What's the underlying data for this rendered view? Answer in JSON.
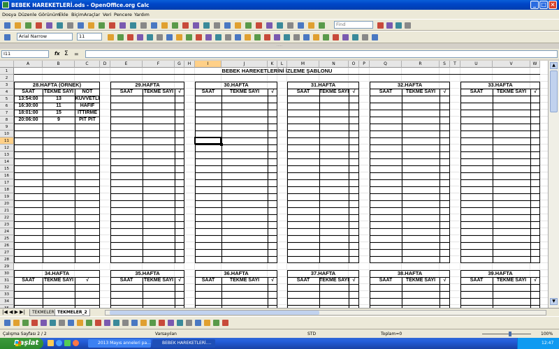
{
  "window": {
    "title": "BEBEK HAREKETLERİ.ods - OpenOffice.org Calc"
  },
  "menu": [
    "Dosya",
    "Düzenle",
    "Görünüm",
    "Ekle",
    "Biçim",
    "Araçlar",
    "Veri",
    "Pencere",
    "Yardım"
  ],
  "toolbar": {
    "find_placeholder": "Find"
  },
  "format": {
    "font": "Arial Narrow",
    "size": "11"
  },
  "formula": {
    "namebox": "I11",
    "value": ""
  },
  "columns": [
    "A",
    "B",
    "C",
    "D",
    "E",
    "F",
    "G",
    "H",
    "I",
    "J",
    "K",
    "L",
    "M",
    "N",
    "O",
    "P",
    "Q",
    "R",
    "S",
    "T",
    "U",
    "V",
    "W"
  ],
  "rows": [
    "1",
    "2",
    "3",
    "4",
    "5",
    "6",
    "7",
    "8",
    "9",
    "10",
    "11",
    "12",
    "13",
    "14",
    "15",
    "16",
    "17",
    "18",
    "19",
    "20",
    "21",
    "22",
    "23",
    "24",
    "25",
    "26",
    "27",
    "28",
    "29",
    "30",
    "31",
    "32",
    "33",
    "34",
    "35"
  ],
  "sheet": {
    "title": "BEBEK HAREKETLERİNİ İZLEME ŞABLONU",
    "top_weeks": [
      "28.HAFTA (ÖRNEK)",
      "29.HAFTA",
      "30.HAFTA",
      "31.HAFTA",
      "32.HAFTA",
      "33.HAFTA"
    ],
    "bottom_weeks": [
      "34.HAFTA",
      "35.HAFTA",
      "36.HAFTA",
      "37.HAFTA",
      "38.HAFTA",
      "39.HAFTA"
    ],
    "col_saat": "SAAT",
    "col_tekme": "TEKME SAYI",
    "col_not": "NOT",
    "col_check": "√",
    "example": [
      {
        "saat": "13:54:00",
        "tekme": "13",
        "not": "KUVVETLİ"
      },
      {
        "saat": "16:30:00",
        "tekme": "11",
        "not": "HAFİF"
      },
      {
        "saat": "18:01:00",
        "tekme": "15",
        "not": "İTTİRME"
      },
      {
        "saat": "20:06:00",
        "tekme": "9",
        "not": "PIT PIT"
      }
    ]
  },
  "tabs": [
    "TEKMELER",
    "TEKMELER_2"
  ],
  "status": {
    "page": "Çalışma Sayfası 2 / 2",
    "style": "Varsayılan",
    "mode": "STD",
    "sum": "Toplam=0",
    "zoom": "100%"
  },
  "taskbar": {
    "start": "Başlat",
    "tasks": [
      "2013 Mayıs anneleri pa...",
      "BEBEK HAREKETLERİ...."
    ],
    "clock": "12:47"
  }
}
